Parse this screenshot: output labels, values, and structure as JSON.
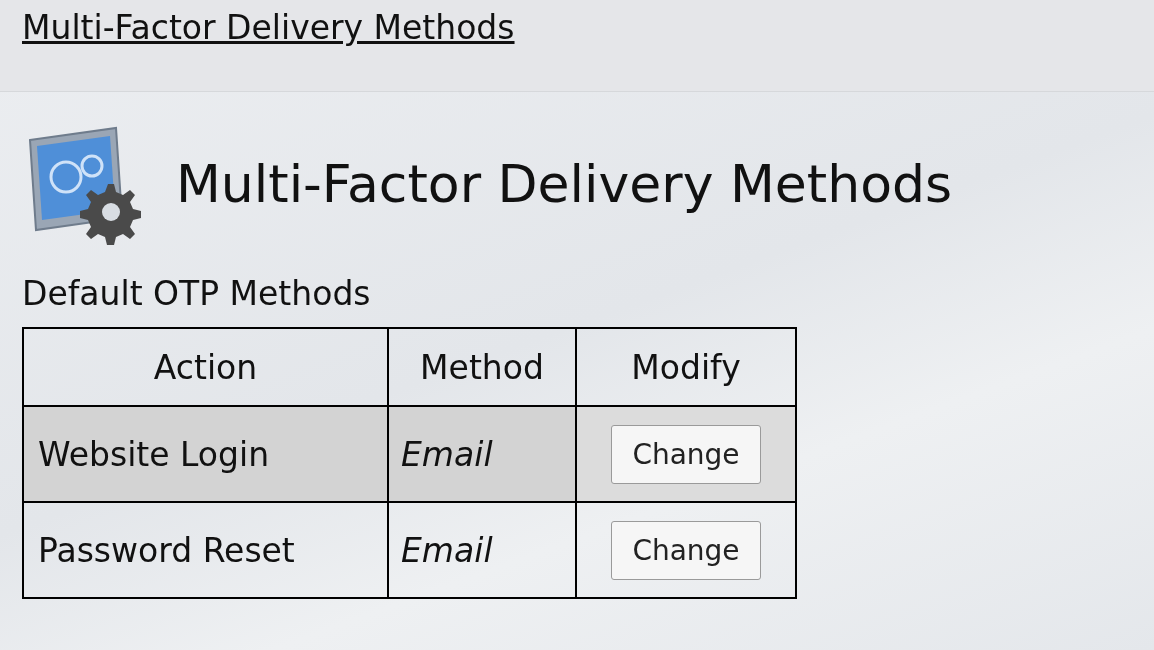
{
  "breadcrumb": {
    "label": "Multi-Factor Delivery Methods"
  },
  "page_title": "Multi-Factor Delivery Methods",
  "section_title": "Default OTP Methods",
  "table": {
    "columns": [
      "Action",
      "Method",
      "Modify"
    ],
    "rows": [
      {
        "action": "Website Login",
        "method": "Email",
        "button": "Change",
        "selected": true
      },
      {
        "action": "Password Reset",
        "method": "Email",
        "button": "Change",
        "selected": false
      }
    ]
  }
}
